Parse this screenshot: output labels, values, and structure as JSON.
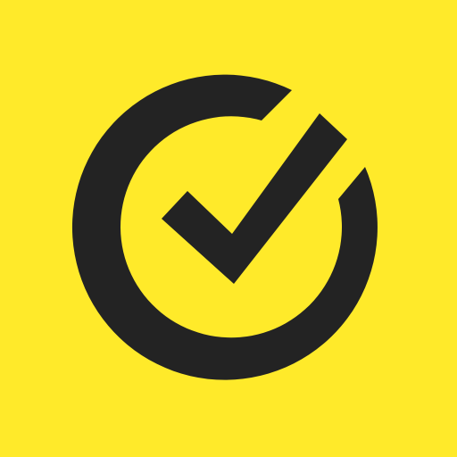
{
  "icon": {
    "name": "check-circle-icon",
    "background_color": "#FFEA2A",
    "foreground_color": "#232323"
  }
}
